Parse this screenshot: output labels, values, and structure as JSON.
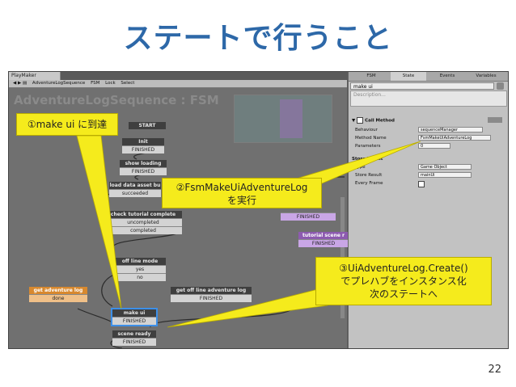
{
  "slide": {
    "title": "ステートで行うこと",
    "page_number": "22"
  },
  "playmaker": {
    "window_tab": "PlayMaker",
    "toolbar": {
      "fsm_selector": "AdventureLogSequence",
      "fsm_dropdown": "FSM",
      "lock": "Lock",
      "select": "Select"
    },
    "graph_title": "AdventureLogSequence : FSM",
    "nodes": [
      {
        "id": "start",
        "title": "START",
        "event": ""
      },
      {
        "id": "init",
        "title": "Init",
        "event": "FINISHED"
      },
      {
        "id": "show-loading",
        "title": "show loading",
        "event": "FINISHED"
      },
      {
        "id": "load-data-asset",
        "title": "load data asset bu",
        "event": "succeeded"
      },
      {
        "id": "check-tutorial",
        "title": "check tutorial complete",
        "event1": "uncompleted",
        "event2": "completed"
      },
      {
        "id": "off-line-mode",
        "title": "off line mode",
        "event1": "yes",
        "event2": "no"
      },
      {
        "id": "get-adventure-log",
        "title": "get adventure log",
        "event": "done"
      },
      {
        "id": "get-off-line-adventure-log",
        "title": "get off line adventure log",
        "event": "FINISHED"
      },
      {
        "id": "make-ui",
        "title": "make ui",
        "event": "FINISHED"
      },
      {
        "id": "scene-ready",
        "title": "scene ready",
        "event": "FINISHED"
      },
      {
        "id": "tutorial-scene-top",
        "title": "",
        "event": "FINISHED"
      },
      {
        "id": "tutorial-scene-r",
        "title": "tutorial scene r",
        "event": "FINISHED"
      }
    ]
  },
  "inspector": {
    "tabs": [
      "FSM",
      "State",
      "Events",
      "Variables"
    ],
    "state_name": "make ui",
    "description_placeholder": "Description...",
    "action_title": "Call Method",
    "fields": [
      {
        "label": "Behaviour",
        "value": "sequenceManager"
      },
      {
        "label": "Method Name",
        "value": "FsmMakeUiAdventureLog"
      },
      {
        "label": "Parameters",
        "value": "0"
      }
    ],
    "store_result_title": "Store Result",
    "store_fields": [
      {
        "label": "Type",
        "value": "Game Object"
      },
      {
        "label": "Store Result",
        "value": "mainUi"
      },
      {
        "label": "Every Frame",
        "value": ""
      }
    ]
  },
  "callouts": {
    "c1": "①make ui に到達",
    "c2_line1": "②FsmMakeUiAdventureLog",
    "c2_line2": "を実行",
    "c3_line1": "③UiAdventureLog.Create()",
    "c3_line2": "でプレハブをインスタンス化",
    "c3_line3": "次のステートへ"
  },
  "colors": {
    "title": "#2d68a8",
    "callout": "#f5eb1c",
    "selection": "#3c8fe8"
  }
}
